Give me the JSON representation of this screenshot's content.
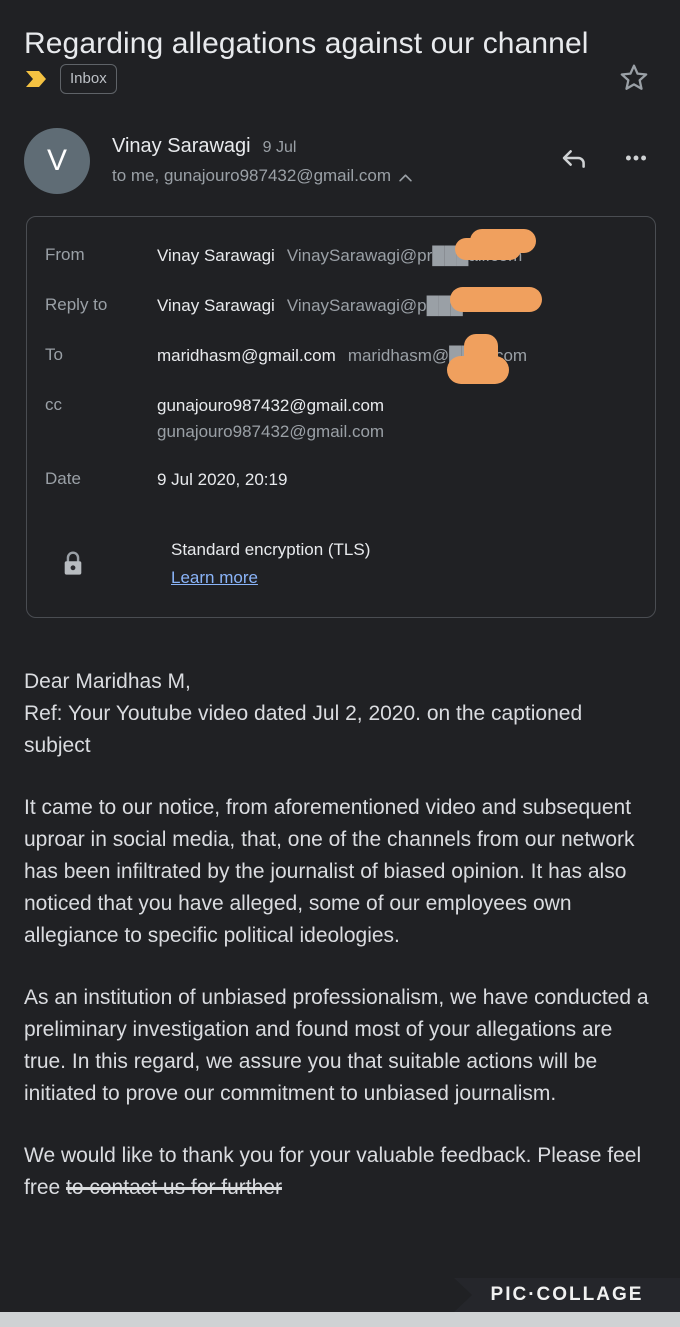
{
  "app": "gmail-dark-message-view",
  "colors": {
    "background": "#202124",
    "text_primary": "#e8eaed",
    "text_secondary": "#9aa0a6",
    "link": "#8ab4f8",
    "important_marker": "#f4c242",
    "avatar": "#5f6c75",
    "redaction": "#f0a05e",
    "panel_border": "#4a4d52"
  },
  "header": {
    "subject": "Regarding allegations against our channel",
    "important_marker_icon": "important-chevron-icon",
    "label_chip": "Inbox",
    "star_icon": "star-outline-icon"
  },
  "sender": {
    "avatar_initial": "V",
    "name": "Vinay Sarawagi",
    "date": "9 Jul",
    "recipients_summary": "to me, gunajouro987432@gmail.com",
    "expand_icon": "chevron-up-icon",
    "reply_icon": "reply-arrow-icon",
    "more_icon": "more-options-icon"
  },
  "details": {
    "rows": [
      {
        "label": "From",
        "primary": "Vinay Sarawagi",
        "secondary": "VinaySarawagi@pr███ail.com"
      },
      {
        "label": "Reply to",
        "primary": "Vinay Sarawagi",
        "secondary": "VinaySarawagi@p███l.com"
      },
      {
        "label": "To",
        "primary": "maridhasm@gmail.com",
        "secondary": "maridhasm@██ail.com"
      },
      {
        "label": "cc",
        "primary": "gunajouro987432@gmail.com",
        "secondary": "gunajouro987432@gmail.com"
      },
      {
        "label": "Date",
        "primary": "9 Jul 2020, 20:19",
        "secondary": ""
      }
    ],
    "encryption": {
      "icon": "lock-closed-icon",
      "text": "Standard encryption (TLS)",
      "link": "Learn more"
    }
  },
  "body": {
    "paragraphs": [
      "Dear Maridhas M,\nRef: Your Youtube video dated Jul 2, 2020. on the captioned subject",
      "It came to our notice, from aforementioned video and subsequent uproar in social media, that, one of the channels from our network has been infiltrated by the journalist of biased opinion. It has also noticed that you have alleged, some of our employees own allegiance to specific political ideologies.",
      "As an institution of unbiased professionalism, we have conducted a preliminary investigation and found most of your allegations are true. In this regard, we assure you that suitable actions will be initiated to prove our commitment to unbiased journalism.",
      "We would like to thank you for your valuable feedback. Please feel free to contact us for further"
    ]
  },
  "watermark": {
    "text": "PIC·COLLAGE"
  }
}
